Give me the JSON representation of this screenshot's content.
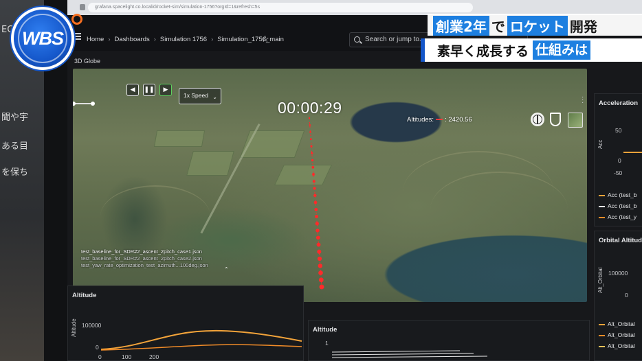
{
  "overlay": {
    "logo_text": "WBS",
    "caption_line1": {
      "part1": "創業2年",
      "part2": "で",
      "part3": "ロケット",
      "part4": "開発"
    },
    "caption_line2": {
      "part1": "素早く成長する",
      "part2": "仕組みは"
    },
    "left_wall_text": [
      "EC",
      "聞や宇",
      "ある目",
      "を保ち"
    ]
  },
  "browser": {
    "url_text": "grafana.spacelight.co.local/d/rocket-sim/simulation-1756?orgId=1&refresh=5s"
  },
  "topnav": {
    "breadcrumb": [
      "Home",
      "Dashboards",
      "Simulation 1756",
      "Simulation_1756_main"
    ],
    "search_placeholder": "Search or jump to..."
  },
  "globe_panel": {
    "title": "3D Globe",
    "speed": "1x Speed",
    "clock": "00:00:29",
    "altitude_label": "Altitudes:",
    "altitude_value": ": 2420.56",
    "files": [
      "test_baseline_for_SDR#2_ascent_2pitch_case1.json",
      "test_baseline_for_SDR#2_ascent_2pitch_case2.json",
      "test_yaw_rate_optimization_test_azimuth...100deg.json"
    ]
  },
  "accel_panel": {
    "title": "Acceleration",
    "ylabel": "Acc",
    "ticks": [
      "50",
      "0",
      "-50"
    ],
    "legend": [
      "Acc (test_b",
      "Acc (test_b",
      "Acc (test_y"
    ],
    "colors": [
      "#f2a33a",
      "#e6e6e6",
      "#f28c28"
    ]
  },
  "orbital_panel": {
    "title": "Orbital Altitude",
    "ylabel": "Alt_Orbital",
    "ticks": [
      "100000",
      "0"
    ],
    "legend": [
      "Alt_Orbital",
      "Alt_Orbital",
      "Alt_Orbital"
    ],
    "colors": [
      "#f2a33a",
      "#f28c28",
      "#e8c35a"
    ]
  },
  "altitude_panel_1": {
    "title": "Altitude",
    "ylabel": "Altitude",
    "ticks_y": [
      "100000",
      "0"
    ],
    "ticks_x": [
      "0",
      "100",
      "200"
    ]
  },
  "altitude_panel_2": {
    "title": "Altitude",
    "ticks_y": [
      "1"
    ]
  }
}
